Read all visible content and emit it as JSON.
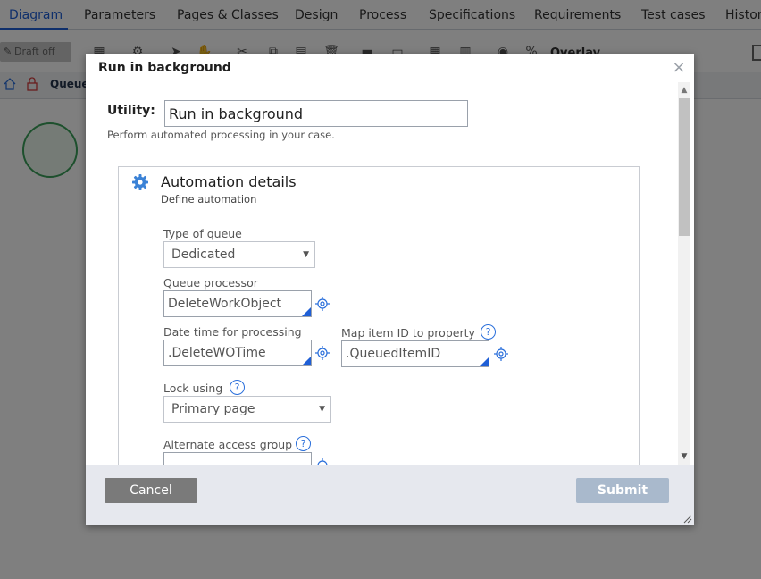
{
  "app": {
    "tabs": [
      {
        "label": "Diagram",
        "active": true
      },
      {
        "label": "Parameters"
      },
      {
        "label": "Pages & Classes"
      },
      {
        "label": "Design"
      },
      {
        "label": "Process"
      },
      {
        "label": "Specifications"
      },
      {
        "label": "Requirements"
      },
      {
        "label": "Test cases"
      },
      {
        "label": "Histor"
      }
    ],
    "toolbar": {
      "draft_label": "Draft off",
      "overlay_label": "Overlay"
    },
    "breadcrumb": {
      "text": "Queue"
    }
  },
  "modal": {
    "title": "Run in background",
    "utility_label": "Utility:",
    "utility_value": "Run in background",
    "utility_description": "Perform automated processing in your case.",
    "section": {
      "title": "Automation details",
      "subtitle": "Define automation",
      "fields": {
        "type_of_queue": {
          "label": "Type of queue",
          "value": "Dedicated"
        },
        "queue_processor": {
          "label": "Queue processor",
          "value": "DeleteWorkObject"
        },
        "date_time": {
          "label": "Date time for processing",
          "value": ".DeleteWOTime"
        },
        "map_item_id": {
          "label": "Map item ID to property",
          "value": ".QueuedItemID"
        },
        "lock_using": {
          "label": "Lock using",
          "value": "Primary page"
        },
        "alternate_access_group": {
          "label": "Alternate access group",
          "value": ""
        }
      }
    },
    "buttons": {
      "cancel": "Cancel",
      "submit": "Submit"
    }
  },
  "colors": {
    "accent": "#1f5fd6",
    "help_blue": "#2a6fdb",
    "cancel_bg": "#7a7a7a",
    "submit_bg": "#a9b9cc",
    "footer_bg": "#e6e8ee"
  }
}
